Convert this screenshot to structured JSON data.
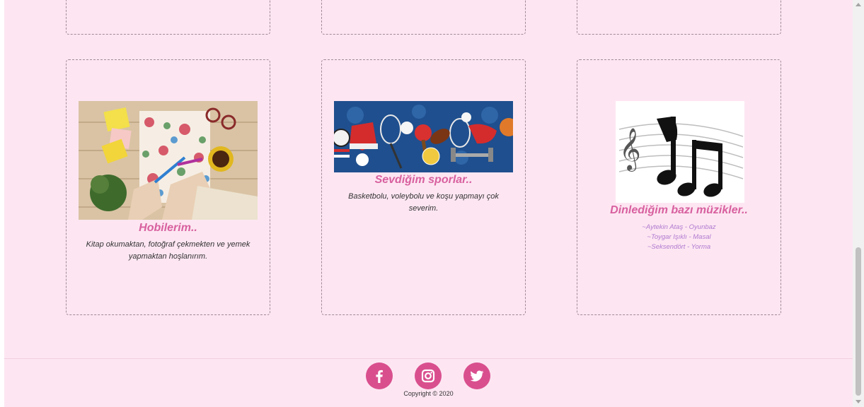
{
  "cards": [
    {
      "image": "coloring-book-photo",
      "title": "Hobilerim..",
      "description": "Kitap okumaktan, fotoğraf çekmekten ve yemek yapmaktan hoşlanırım."
    },
    {
      "image": "sports-equipment-banner",
      "title": "Sevdiğim sporlar..",
      "description": "Basketbolu, voleybolu ve koşu yapmayı çok severim."
    },
    {
      "image": "music-notes-picture",
      "title": "Dinlediğim bazı müzikler..",
      "songs": [
        "~Aytekin Ataş - Oyunbaz",
        "~Toygar Işıklı - Masal",
        "~Seksendört - Yorma"
      ]
    }
  ],
  "footer": {
    "social": [
      "facebook-icon",
      "instagram-icon",
      "twitter-icon"
    ],
    "copyright": "Copyright © 2020"
  },
  "colors": {
    "background": "#fde6f2",
    "accent": "#d94f8e",
    "title": "#d8609f",
    "music_text": "#b07ad0"
  }
}
